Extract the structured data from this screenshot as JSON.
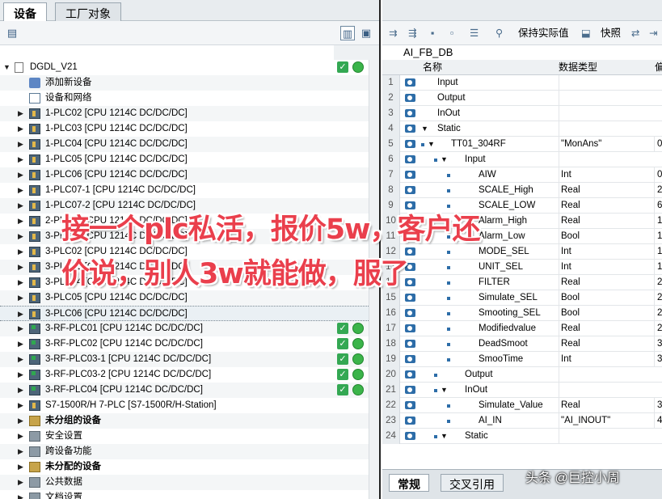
{
  "left_tabs": [
    "设备",
    "工厂对象"
  ],
  "tree": [
    {
      "label": "DGDL_V21",
      "arrow": "down",
      "indent": 0,
      "icon": "project",
      "status": true
    },
    {
      "label": "添加新设备",
      "arrow": "",
      "indent": 1,
      "icon": "add-device"
    },
    {
      "label": "设备和网络",
      "arrow": "",
      "indent": 1,
      "icon": "network"
    },
    {
      "label": "1-PLC02 [CPU 1214C DC/DC/DC]",
      "arrow": "right",
      "indent": 1,
      "icon": "plc"
    },
    {
      "label": "1-PLC03 [CPU 1214C DC/DC/DC]",
      "arrow": "right",
      "indent": 1,
      "icon": "plc"
    },
    {
      "label": "1-PLC04 [CPU 1214C DC/DC/DC]",
      "arrow": "right",
      "indent": 1,
      "icon": "plc"
    },
    {
      "label": "1-PLC05 [CPU 1214C DC/DC/DC]",
      "arrow": "right",
      "indent": 1,
      "icon": "plc"
    },
    {
      "label": "1-PLC06 [CPU 1214C DC/DC/DC]",
      "arrow": "right",
      "indent": 1,
      "icon": "plc"
    },
    {
      "label": "1-PLC07-1 [CPU 1214C DC/DC/DC]",
      "arrow": "right",
      "indent": 1,
      "icon": "plc"
    },
    {
      "label": "1-PLC07-2 [CPU 1214C DC/DC/DC]",
      "arrow": "right",
      "indent": 1,
      "icon": "plc"
    },
    {
      "label": "2-PLC01 [CPU 1214C DC/DC/DC]",
      "arrow": "right",
      "indent": 1,
      "icon": "plc"
    },
    {
      "label": "3-PLC01 [CPU 1214C DC/DC/DC]",
      "arrow": "right",
      "indent": 1,
      "icon": "plc"
    },
    {
      "label": "3-PLC02 [CPU 1214C DC/DC/DC]",
      "arrow": "right",
      "indent": 1,
      "icon": "plc"
    },
    {
      "label": "3-PLC03 [CPU 1214C DC/DC/DC]",
      "arrow": "right",
      "indent": 1,
      "icon": "plc"
    },
    {
      "label": "3-PLC04 [CPU 1214C DC/DC/DC]",
      "arrow": "right",
      "indent": 1,
      "icon": "plc"
    },
    {
      "label": "3-PLC05 [CPU 1214C DC/DC/DC]",
      "arrow": "right",
      "indent": 1,
      "icon": "plc"
    },
    {
      "label": "3-PLC06 [CPU 1214C DC/DC/DC]",
      "arrow": "right",
      "indent": 1,
      "icon": "plc",
      "selected": true
    },
    {
      "label": "3-RF-PLC01 [CPU 1214C DC/DC/DC]",
      "arrow": "right",
      "indent": 1,
      "icon": "rf",
      "status": true
    },
    {
      "label": "3-RF-PLC02 [CPU 1214C DC/DC/DC]",
      "arrow": "right",
      "indent": 1,
      "icon": "rf",
      "status": true
    },
    {
      "label": "3-RF-PLC03-1 [CPU 1214C DC/DC/DC]",
      "arrow": "right",
      "indent": 1,
      "icon": "rf",
      "status": true
    },
    {
      "label": "3-RF-PLC03-2 [CPU 1214C DC/DC/DC]",
      "arrow": "right",
      "indent": 1,
      "icon": "rf",
      "status": true
    },
    {
      "label": "3-RF-PLC04 [CPU 1214C DC/DC/DC]",
      "arrow": "right",
      "indent": 1,
      "icon": "rf",
      "status": true
    },
    {
      "label": "S7-1500R/H 7-PLC [S7-1500R/H-Station]",
      "arrow": "right",
      "indent": 1,
      "icon": "plc"
    },
    {
      "label": "未分组的设备",
      "arrow": "right",
      "indent": 1,
      "icon": "folder",
      "bold": true
    },
    {
      "label": "安全设置",
      "arrow": "right",
      "indent": 1,
      "icon": "gray"
    },
    {
      "label": "跨设备功能",
      "arrow": "right",
      "indent": 1,
      "icon": "gray"
    },
    {
      "label": "未分配的设备",
      "arrow": "right",
      "indent": 1,
      "icon": "folder",
      "bold": true
    },
    {
      "label": "公共数据",
      "arrow": "right",
      "indent": 1,
      "icon": "gray"
    },
    {
      "label": "文档设置",
      "arrow": "right",
      "indent": 1,
      "icon": "gray"
    }
  ],
  "right_toolbar": {
    "keep_actual": "保持实际值",
    "snapshot": "快照"
  },
  "db_title": "AI_FB_DB",
  "grid_headers": {
    "name": "名称",
    "type": "数据类型",
    "start": "偏"
  },
  "grid_rows": [
    {
      "n": "1",
      "name": "Input",
      "type": "",
      "val": "",
      "level": 0,
      "tri": "",
      "bullet": false
    },
    {
      "n": "2",
      "name": "Output",
      "type": "",
      "val": "",
      "level": 0,
      "tri": "",
      "bullet": false
    },
    {
      "n": "3",
      "name": "InOut",
      "type": "",
      "val": "",
      "level": 0,
      "tri": "",
      "bullet": false
    },
    {
      "n": "4",
      "name": "Static",
      "type": "",
      "val": "",
      "level": 0,
      "tri": "down",
      "bullet": false
    },
    {
      "n": "5",
      "name": "TT01_304RF",
      "type": "\"MonAns\"",
      "val": "0",
      "level": 1,
      "tri": "down",
      "bullet": true
    },
    {
      "n": "6",
      "name": "Input",
      "type": "",
      "val": "",
      "level": 2,
      "tri": "down",
      "bullet": true
    },
    {
      "n": "7",
      "name": "AIW",
      "type": "Int",
      "val": "0",
      "level": 3,
      "tri": "",
      "bullet": true
    },
    {
      "n": "8",
      "name": "SCALE_High",
      "type": "Real",
      "val": "2",
      "level": 3,
      "tri": "",
      "bullet": true
    },
    {
      "n": "9",
      "name": "SCALE_LOW",
      "type": "Real",
      "val": "6",
      "level": 3,
      "tri": "",
      "bullet": true
    },
    {
      "n": "10",
      "name": "Alarm_High",
      "type": "Real",
      "val": "1",
      "level": 3,
      "tri": "",
      "bullet": true
    },
    {
      "n": "11",
      "name": "Alarm_Low",
      "type": "Bool",
      "val": "1",
      "level": 3,
      "tri": "",
      "bullet": true
    },
    {
      "n": "12",
      "name": "MODE_SEL",
      "type": "Int",
      "val": "1",
      "level": 3,
      "tri": "",
      "bullet": true
    },
    {
      "n": "13",
      "name": "UNIT_SEL",
      "type": "Int",
      "val": "1",
      "level": 3,
      "tri": "",
      "bullet": true
    },
    {
      "n": "14",
      "name": "FILTER",
      "type": "Real",
      "val": "2",
      "level": 3,
      "tri": "",
      "bullet": true
    },
    {
      "n": "15",
      "name": "Simulate_SEL",
      "type": "Bool",
      "val": "2",
      "level": 3,
      "tri": "",
      "bullet": true
    },
    {
      "n": "16",
      "name": "Smooting_SEL",
      "type": "Bool",
      "val": "2",
      "level": 3,
      "tri": "",
      "bullet": true
    },
    {
      "n": "17",
      "name": "Modifiedvalue",
      "type": "Real",
      "val": "2",
      "level": 3,
      "tri": "",
      "bullet": true
    },
    {
      "n": "18",
      "name": "DeadSmoot",
      "type": "Real",
      "val": "3",
      "level": 3,
      "tri": "",
      "bullet": true
    },
    {
      "n": "19",
      "name": "SmooTime",
      "type": "Int",
      "val": "3",
      "level": 3,
      "tri": "",
      "bullet": true
    },
    {
      "n": "20",
      "name": "Output",
      "type": "",
      "val": "",
      "level": 2,
      "tri": "",
      "bullet": true
    },
    {
      "n": "21",
      "name": "InOut",
      "type": "",
      "val": "",
      "level": 2,
      "tri": "down",
      "bullet": true
    },
    {
      "n": "22",
      "name": "Simulate_Value",
      "type": "Real",
      "val": "3",
      "level": 3,
      "tri": "",
      "bullet": true
    },
    {
      "n": "23",
      "name": "AI_IN",
      "type": "\"AI_INOUT\"",
      "val": "4",
      "level": 3,
      "tri": "",
      "bullet": true
    },
    {
      "n": "24",
      "name": "Static",
      "type": "",
      "val": "",
      "level": 2,
      "tri": "down",
      "bullet": true
    }
  ],
  "bottom_tabs": [
    "常规",
    "交叉引用"
  ],
  "caption": {
    "line1": "接一个plc私活，报价5w，客户还",
    "line2": "价说，别人3w就能做，服了"
  },
  "watermark": "头条 @巨控小周",
  "colors": {
    "caption_red": "#ea3f4c",
    "status_green": "#34a853",
    "db_icon_blue": "#2d6da8"
  }
}
